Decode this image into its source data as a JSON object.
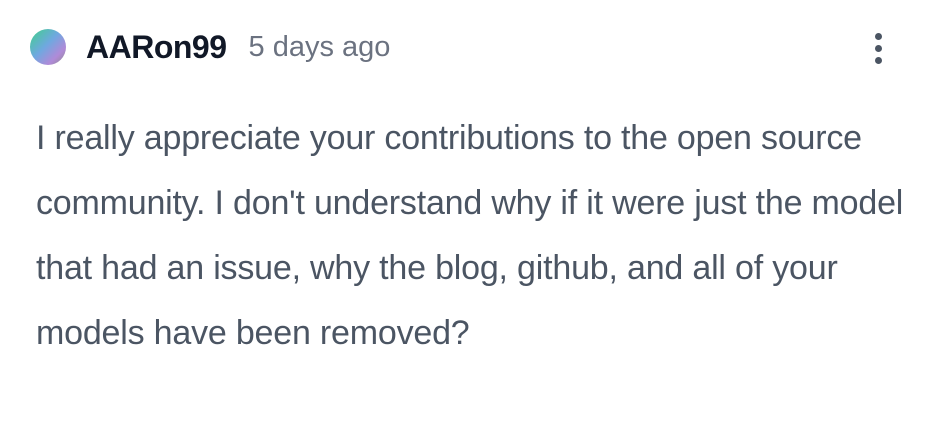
{
  "comment": {
    "author": "AARon99",
    "timestamp": "5 days ago",
    "text": "I really appreciate your contributions to the open source community. I don't understand why if it were just the model that had an issue, why the blog, github, and all of your models have been removed?",
    "menu_icon": "more-vertical-icon",
    "colors": {
      "author": "#111827",
      "timestamp": "#6b7280",
      "text": "#4b5563"
    }
  }
}
